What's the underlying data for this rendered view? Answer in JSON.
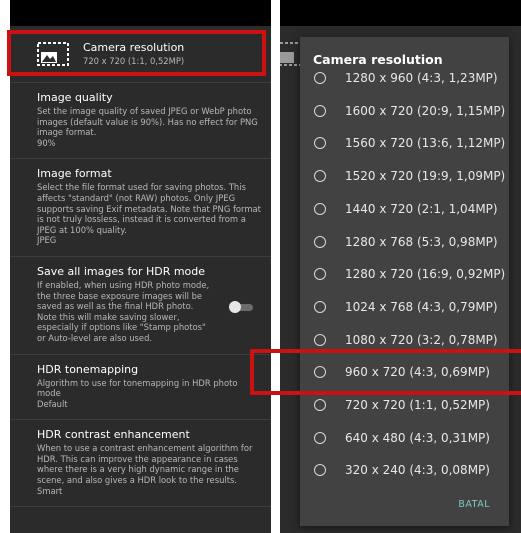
{
  "settings_screen": {
    "camera_resolution": {
      "title": "Camera resolution",
      "value": "720 x 720 (1:1, 0,52MP)",
      "icon": "camera-resolution-icon"
    },
    "items": [
      {
        "title": "Image quality",
        "description": "Set the image quality of saved JPEG or WebP photo images (default value is 90%). Has no effect for PNG image format.",
        "value": "90%"
      },
      {
        "title": "Image format",
        "description": "Select the file format used for saving photos. This affects \"standard\" (not RAW) photos. Only JPEG supports saving Exif metadata. Note that PNG format is not truly lossless, instead it is converted from a JPEG at 100% quality.",
        "value": "JPEG"
      },
      {
        "title": "Save all images for HDR mode",
        "description": "If enabled, when using HDR photo mode, the three base exposure images will be saved as well as the final HDR photo. Note this will make saving slower, especially if options like \"Stamp photos\" or Auto-level are also used.",
        "value": "",
        "toggle_on": false
      },
      {
        "title": "HDR tonemapping",
        "description": "Algorithm to use for tonemapping in HDR photo mode",
        "value": "Default"
      },
      {
        "title": "HDR contrast enhancement",
        "description": "When to use a contrast enhancement algorithm for HDR. This can improve the appearance in cases where there is a very high dynamic range in the scene, and also gives a HDR look to the results.",
        "value": "Smart"
      }
    ]
  },
  "dialog": {
    "title": "Camera resolution",
    "options": [
      "1280 x 960 (4:3, 1,23MP)",
      "1600 x 720 (20:9, 1,15MP)",
      "1560 x 720 (13:6, 1,12MP)",
      "1520 x 720 (19:9, 1,09MP)",
      "1440 x 720 (2:1, 1,04MP)",
      "1280 x 768 (5:3, 0,98MP)",
      "1280 x 720 (16:9, 0,92MP)",
      "1024 x 768 (4:3, 0,79MP)",
      "1080 x 720 (3:2, 0,78MP)",
      "960 x 720 (4:3, 0,69MP)",
      "720 x 720 (1:1, 0,52MP)",
      "640 x 480 (4:3, 0,31MP)",
      "320 x 240 (4:3, 0,08MP)"
    ],
    "cancel_label": "BATAL"
  },
  "colors": {
    "background": "#2b2b2b",
    "dialog": "#424242",
    "accent": "#7ec7c0",
    "highlight": "#cc1111"
  }
}
